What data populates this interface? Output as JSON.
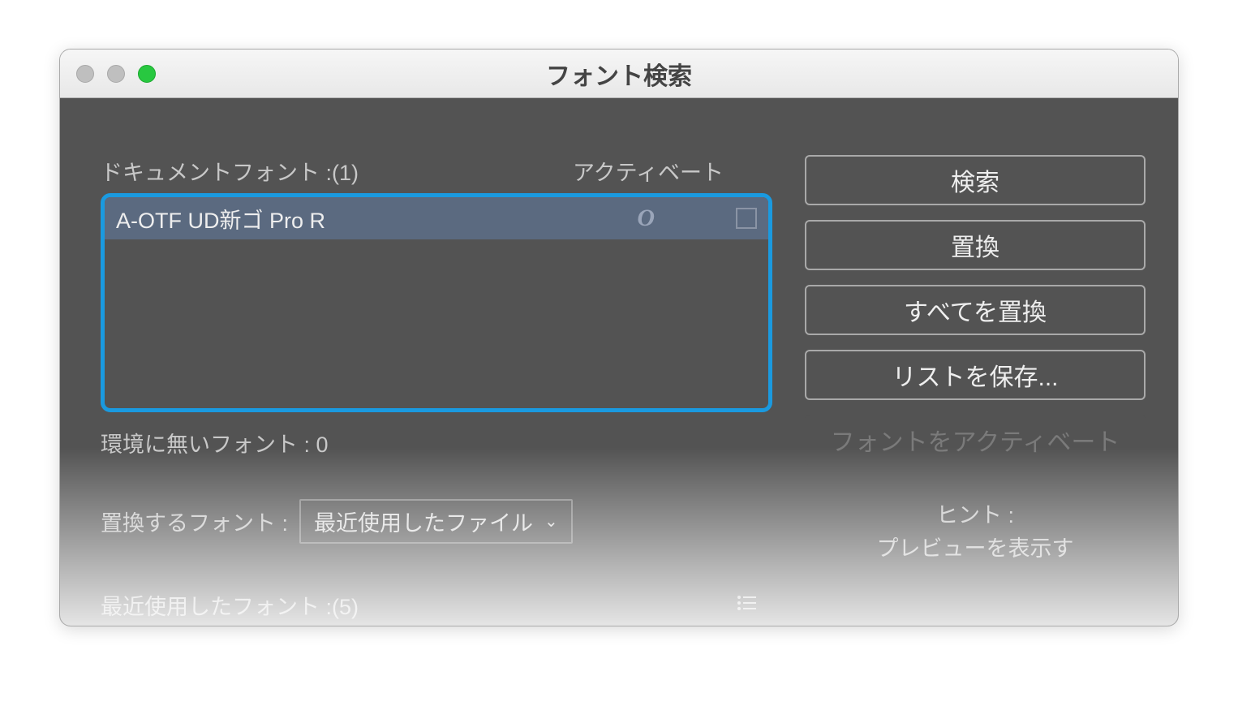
{
  "window": {
    "title": "フォント検索"
  },
  "listHeader": {
    "docFonts": "ドキュメントフォント :(1)",
    "activate": "アクティベート"
  },
  "fontList": {
    "items": [
      {
        "name": "A-OTF UD新ゴ Pro R",
        "typeGlyph": "O"
      }
    ]
  },
  "missingFonts": "環境に無いフォント : 0",
  "replace": {
    "label": "置換するフォント :",
    "selected": "最近使用したファイル"
  },
  "recentFonts": "最近使用したフォント :(5)",
  "buttons": {
    "search": "検索",
    "replace": "置換",
    "replaceAll": "すべてを置換",
    "saveList": "リストを保存...",
    "activateFont": "フォントをアクティベート"
  },
  "hint": {
    "title": "ヒント :",
    "body": "プレビューを表示す"
  }
}
